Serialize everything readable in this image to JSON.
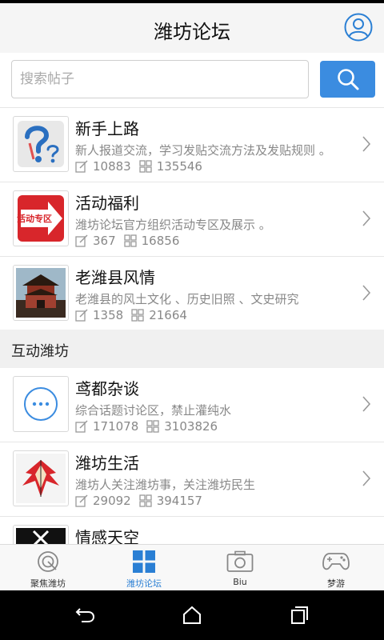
{
  "header": {
    "title": "潍坊论坛"
  },
  "search": {
    "placeholder": "搜索帖子",
    "value": ""
  },
  "forums_top": [
    {
      "name": "新手上路",
      "description": "新人报道交流，学习发贴交流方法及发贴规则 。",
      "posts": "10883",
      "replies": "135546",
      "icon": "question-mark-pencil-icon"
    },
    {
      "name": "活动福利",
      "description": "潍坊论坛官方组织活动专区及展示 。",
      "posts": "367",
      "replies": "16856",
      "icon": "activity-arrow-icon",
      "icon_text": "活动专区"
    },
    {
      "name": "老潍县风情",
      "description": "老潍县的风土文化 、历史旧照 、文史研究",
      "posts": "1358",
      "replies": "21664",
      "icon": "old-gate-tower-icon"
    }
  ],
  "section": {
    "title": "互动潍坊"
  },
  "forums_bottom": [
    {
      "name": "鸢都杂谈",
      "description": "综合话题讨论区，禁止灌纯水",
      "posts": "171078",
      "replies": "3103826",
      "icon": "chat-bubble-icon"
    },
    {
      "name": "潍坊生活",
      "description": "潍坊人关注潍坊事，关注潍坊民生",
      "posts": "29092",
      "replies": "394157",
      "icon": "kite-icon"
    },
    {
      "name": "情感天空",
      "description": "",
      "posts": "",
      "replies": "",
      "icon": "heart-x-icon"
    }
  ],
  "tabs": [
    {
      "label": "聚焦潍坊",
      "icon": "target-icon"
    },
    {
      "label": "潍坊论坛",
      "icon": "grid-icon",
      "active": true
    },
    {
      "label": "Biu",
      "icon": "camera-icon"
    },
    {
      "label": "梦游",
      "icon": "gamepad-icon"
    }
  ],
  "colors": {
    "accent": "#3b8ce0",
    "active_tab": "#2a7fd4",
    "inactive_tab": "#888888"
  }
}
